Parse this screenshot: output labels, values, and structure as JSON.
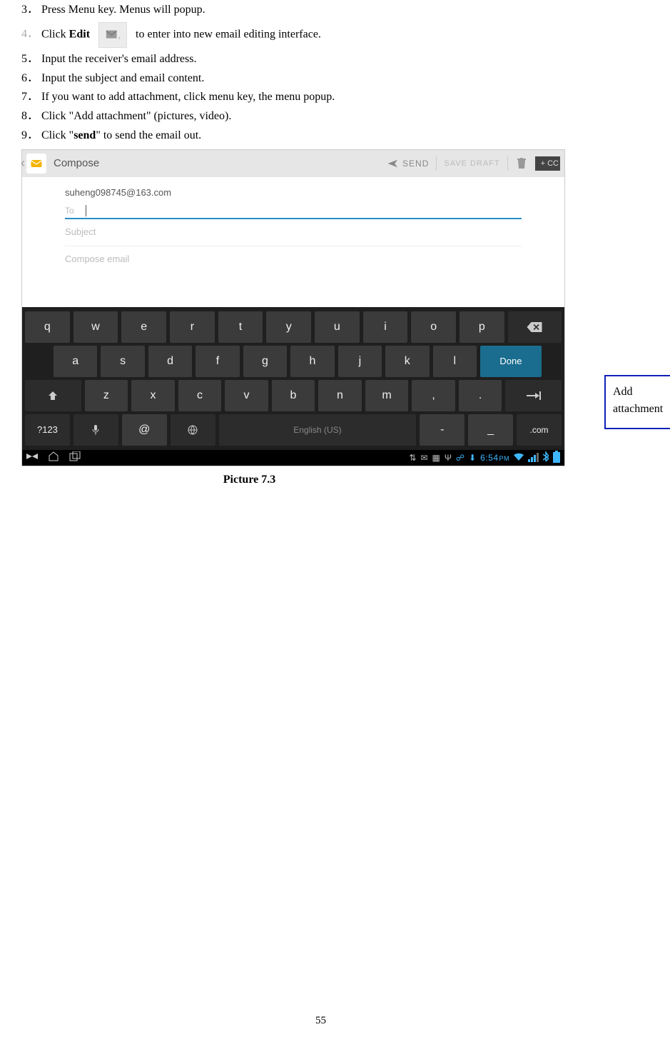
{
  "list": {
    "n3": "3．",
    "t3": "Press Menu key. Menus will popup.",
    "n4": "4．",
    "t4a": "Click ",
    "t4b": "Edit",
    "t4c": " to enter into new email editing interface.",
    "n5": "5．",
    "t5": "Input the receiver's email address.",
    "n6": "6．",
    "t6": "Input the subject and email content.",
    "n7": "7．",
    "t7": "If you want to add attachment, click menu key, the menu popup.",
    "n8": "8．",
    "t8": "Click \"Add attachment\" (pictures, video).",
    "n9": "9．",
    "t9a": "Click \"",
    "t9b": "send",
    "t9c": "\" to send the email out."
  },
  "shot": {
    "compose": "Compose",
    "send": "SEND",
    "save": "SAVE DRAFT",
    "cc": "+ CC",
    "from": "suheng098745@163.com",
    "to": "To",
    "subject": "Subject",
    "body": "Compose email"
  },
  "kb": {
    "r1": [
      "q",
      "w",
      "e",
      "r",
      "t",
      "y",
      "u",
      "i",
      "o",
      "p"
    ],
    "r2": [
      "a",
      "s",
      "d",
      "f",
      "g",
      "h",
      "j",
      "k",
      "l"
    ],
    "done": "Done",
    "r3": [
      "z",
      "x",
      "c",
      "v",
      "b",
      "n",
      "m",
      ",",
      "."
    ],
    "num": "?123",
    "at": "@",
    "space": "English (US)",
    "dash": "-",
    "under": "_",
    "com": ".com"
  },
  "status": {
    "time": "6:54",
    "ampm": "PM"
  },
  "callout": {
    "l1": "Add",
    "l2": "attachment"
  },
  "caption": "Picture 7.3",
  "pagenum": "55"
}
